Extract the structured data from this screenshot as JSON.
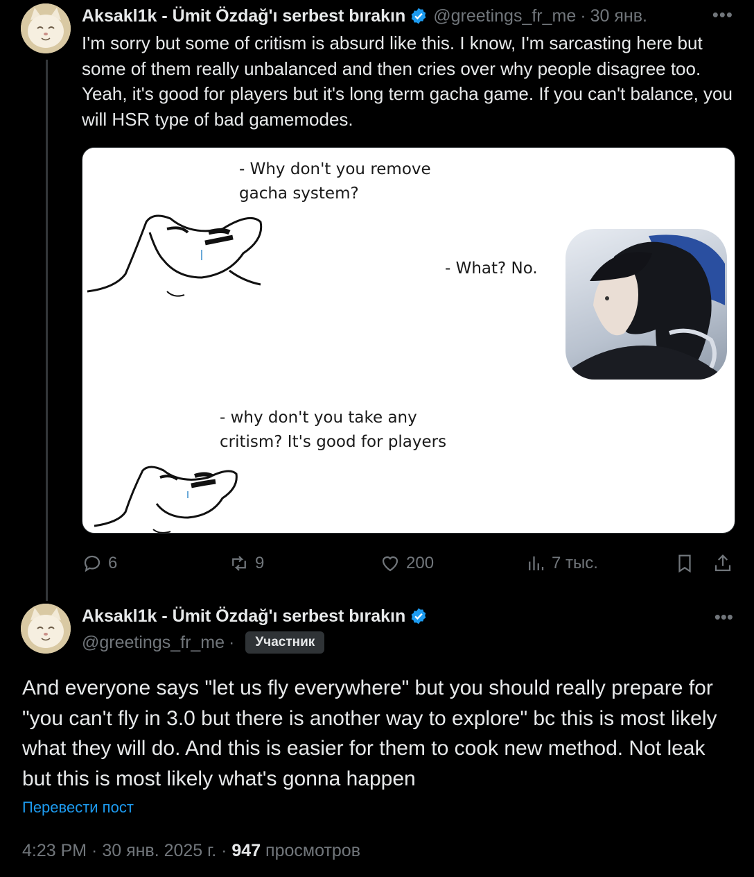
{
  "tweet1": {
    "author_name": "Aksakl1k - Ümit Özdağ'ı serbest bırakın",
    "handle": "@greetings_fr_me",
    "separator": "·",
    "date": "30 янв.",
    "more": "•••",
    "text": "I'm sorry but some of critism is absurd like this. I know, I'm sarcasting here but some of them really unbalanced and then cries over why people disagree too. Yeah, it's good for players but it's long term gacha game. If you can't balance, you will HSR type of bad gamemodes.",
    "meme": {
      "q1_line1": "- Why don't you remove",
      "q1_line2": "gacha system?",
      "answer": "- What? No.",
      "q2_line1": "- why don't you take any",
      "q2_line2": "critism? It's good for players"
    },
    "actions": {
      "replies": "6",
      "reposts": "9",
      "likes": "200",
      "views": "7 тыс."
    },
    "icons": [
      "reply-icon",
      "repost-icon",
      "like-icon",
      "views-icon",
      "bookmark-icon",
      "share-icon"
    ]
  },
  "tweet2": {
    "author_name": "Aksakl1k - Ümit Özdağ'ı serbest bırakın",
    "handle": "@greetings_fr_me",
    "separator": "·",
    "badge": "Участник",
    "more": "•••",
    "text": "And everyone says \"let us fly everywhere\" but you should really prepare for \"you can't fly in 3.0 but there is another way to explore\" bc this is most likely what they will do. And this is easier for them to cook new method. Not leak but this is most likely what's gonna happen",
    "translate": "Перевести пост",
    "meta_time": "4:23 PM · 30 янв. 2025 г. · ",
    "meta_views": "947",
    "meta_views_label": " просмотров"
  },
  "colors": {
    "background": "#000000",
    "text": "#e7e9ea",
    "muted": "#71767b",
    "link": "#1d9bf0",
    "verified": "#1d9bf0"
  }
}
